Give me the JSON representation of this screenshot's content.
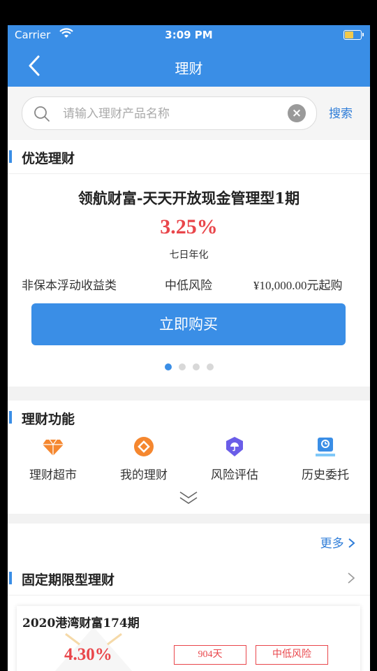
{
  "status": {
    "carrier": "Carrier",
    "time": "3:09 PM"
  },
  "nav": {
    "title": "理财"
  },
  "search": {
    "placeholder": "请输入理财产品名称",
    "button": "搜索"
  },
  "featured": {
    "section_title": "优选理财",
    "product_name": "领航财富-天天开放现金管理型1期",
    "rate": "3.25%",
    "rate_label": "七日年化",
    "type": "非保本浮动收益类",
    "risk": "中低风险",
    "min_purchase": "¥10,000.00元起购",
    "buy_label": "立即购买",
    "carousel_active_index": 0,
    "carousel_count": 4
  },
  "functions": {
    "section_title": "理财功能",
    "items": [
      {
        "label": "理财超市",
        "icon": "diamond-icon",
        "color": "#f5872f"
      },
      {
        "label": "我的理财",
        "icon": "coin-icon",
        "color": "#f5872f"
      },
      {
        "label": "风险评估",
        "icon": "shield-umbrella-icon",
        "color": "#6a5de8"
      },
      {
        "label": "历史委托",
        "icon": "history-icon",
        "color": "#3a8ee6"
      }
    ]
  },
  "fixed": {
    "more_label": "更多",
    "section_title": "固定期限型理财",
    "card": {
      "title": "2020港湾财富174期",
      "rate": "4.30%",
      "term": "904天",
      "risk": "中低风险"
    }
  },
  "colors": {
    "primary": "#3a8ee6",
    "rate_red": "#e9464b",
    "link": "#2f7dd8"
  }
}
